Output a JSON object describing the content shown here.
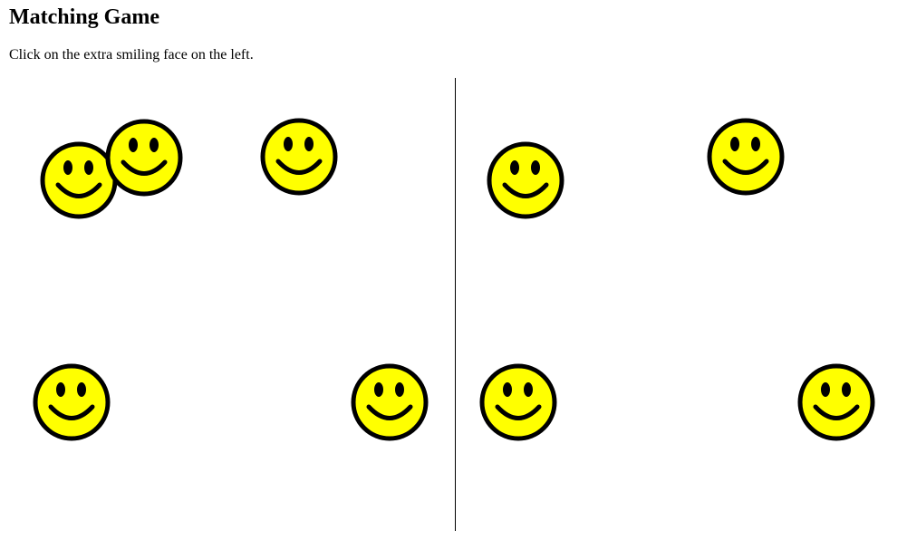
{
  "title": "Matching Game",
  "instructions": "Click on the extra smiling face on the left.",
  "colors": {
    "face_fill": "#ffff00",
    "face_stroke": "#000000",
    "divider": "#000000"
  },
  "icon": "smiley-face-icon",
  "left_board": {
    "face_count": 5
  },
  "right_board": {
    "face_count": 4
  }
}
